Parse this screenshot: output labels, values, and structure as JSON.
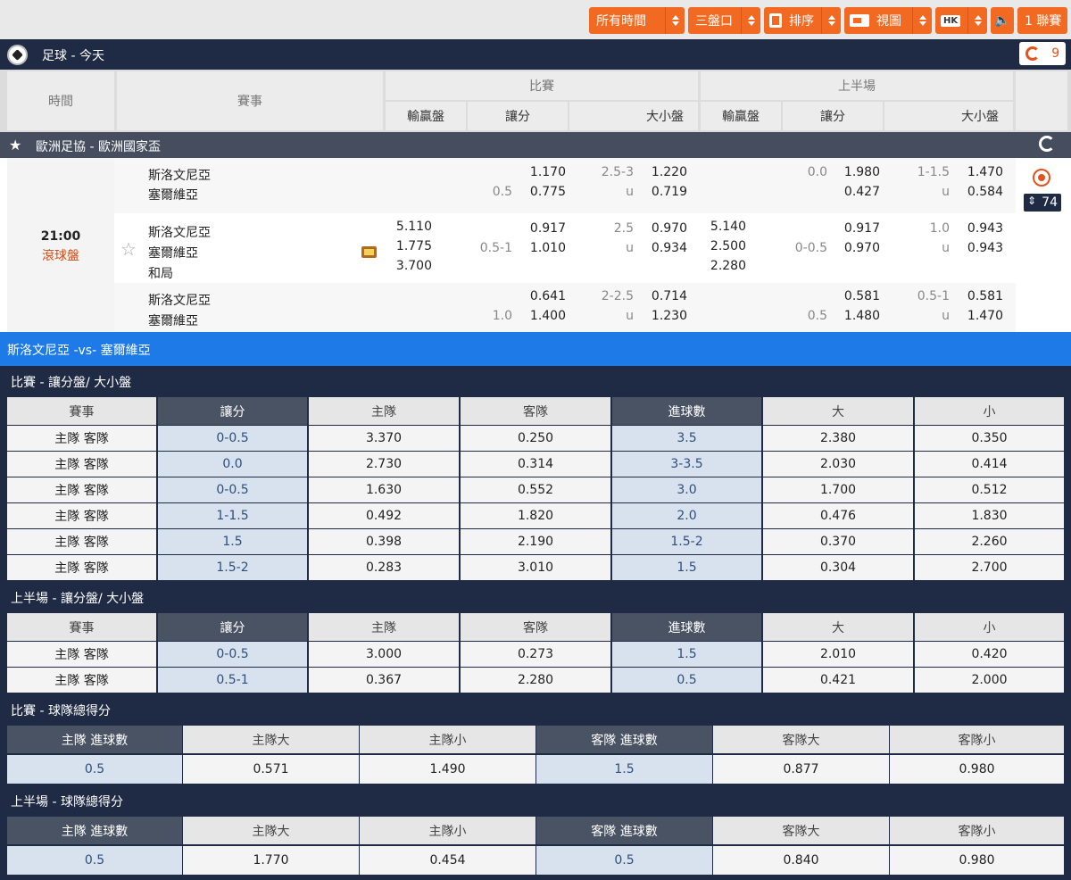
{
  "toolbar": {
    "all_time": "所有時間",
    "three_lines": "三盤口",
    "sort": "排序",
    "view": "視圖",
    "odds_format": "HK",
    "matches": "1 聯賽",
    "accent_color": "#f26a22"
  },
  "sport_header": {
    "title": "足球 - 今天",
    "refresh_count": "9"
  },
  "odds_header": {
    "time": "時間",
    "event": "賽事",
    "full_time": "比賽",
    "first_half": "上半場",
    "cols": [
      "輸贏盤",
      "讓分",
      "大小盤",
      "輸贏盤",
      "讓分",
      "大小盤"
    ]
  },
  "league": {
    "name": "歐洲足協 - 歐洲國家盃"
  },
  "match": {
    "time": "21:00",
    "status": "滾球盤",
    "more_count": "74",
    "rows": [
      {
        "teams": [
          "斯洛文尼亞",
          "塞爾維亞"
        ],
        "ft_1x2": [
          "",
          ""
        ],
        "ft_hdp_line": [
          "",
          "0.5"
        ],
        "ft_hdp_odds": [
          "1.170",
          "0.775"
        ],
        "ft_ou_line": [
          "2.5-3",
          "u"
        ],
        "ft_ou_odds": [
          "1.220",
          "0.719"
        ],
        "h1_1x2": [
          "",
          ""
        ],
        "h1_hdp_line": [
          "0.0",
          ""
        ],
        "h1_hdp_odds": [
          "1.980",
          "0.427"
        ],
        "h1_ou_line": [
          "1-1.5",
          "u"
        ],
        "h1_ou_odds": [
          "1.470",
          "0.584"
        ]
      },
      {
        "teams": [
          "斯洛文尼亞",
          "塞爾維亞",
          "和局"
        ],
        "ft_1x2": [
          "5.110",
          "1.775",
          "3.700"
        ],
        "ft_hdp_line": [
          "",
          "0.5-1"
        ],
        "ft_hdp_odds": [
          "0.917",
          "1.010"
        ],
        "ft_ou_line": [
          "2.5",
          "u"
        ],
        "ft_ou_odds": [
          "0.970",
          "0.934"
        ],
        "h1_1x2": [
          "5.140",
          "2.500",
          "2.280"
        ],
        "h1_hdp_line": [
          "",
          "0-0.5"
        ],
        "h1_hdp_odds": [
          "0.917",
          "0.970"
        ],
        "h1_ou_line": [
          "1.0",
          "u"
        ],
        "h1_ou_odds": [
          "0.943",
          "0.943"
        ]
      },
      {
        "teams": [
          "斯洛文尼亞",
          "塞爾維亞"
        ],
        "ft_1x2": [
          "",
          ""
        ],
        "ft_hdp_line": [
          "",
          "1.0"
        ],
        "ft_hdp_odds": [
          "0.641",
          "1.400"
        ],
        "ft_ou_line": [
          "2-2.5",
          "u"
        ],
        "ft_ou_odds": [
          "0.714",
          "1.230"
        ],
        "h1_1x2": [
          "",
          ""
        ],
        "h1_hdp_line": [
          "",
          "0.5"
        ],
        "h1_hdp_odds": [
          "0.581",
          "1.480"
        ],
        "h1_ou_line": [
          "0.5-1",
          "u"
        ],
        "h1_ou_odds": [
          "0.581",
          "1.470"
        ]
      }
    ]
  },
  "vs_title": "斯洛文尼亞 -vs- 塞爾維亞",
  "ft_hdp_ou": {
    "title": "比賽 - 讓分盤/ 大小盤",
    "headers": [
      "賽事",
      "讓分",
      "主隊",
      "客隊",
      "進球數",
      "大",
      "小"
    ],
    "rows": [
      [
        "主隊 客隊",
        "0-0.5",
        "3.370",
        "0.250",
        "3.5",
        "2.380",
        "0.350"
      ],
      [
        "主隊 客隊",
        "0.0",
        "2.730",
        "0.314",
        "3-3.5",
        "2.030",
        "0.414"
      ],
      [
        "主隊 客隊",
        "0-0.5",
        "1.630",
        "0.552",
        "3.0",
        "1.700",
        "0.512"
      ],
      [
        "主隊 客隊",
        "1-1.5",
        "0.492",
        "1.820",
        "2.0",
        "0.476",
        "1.830"
      ],
      [
        "主隊 客隊",
        "1.5",
        "0.398",
        "2.190",
        "1.5-2",
        "0.370",
        "2.260"
      ],
      [
        "主隊 客隊",
        "1.5-2",
        "0.283",
        "3.010",
        "1.5",
        "0.304",
        "2.700"
      ]
    ]
  },
  "h1_hdp_ou": {
    "title": "上半場 - 讓分盤/ 大小盤",
    "headers": [
      "賽事",
      "讓分",
      "主隊",
      "客隊",
      "進球數",
      "大",
      "小"
    ],
    "rows": [
      [
        "主隊 客隊",
        "0-0.5",
        "3.000",
        "0.273",
        "1.5",
        "2.010",
        "0.420"
      ],
      [
        "主隊 客隊",
        "0.5-1",
        "0.367",
        "2.280",
        "0.5",
        "0.421",
        "2.000"
      ]
    ]
  },
  "ft_team_total": {
    "title": "比賽 - 球隊總得分",
    "headers": [
      "主隊 進球數",
      "主隊大",
      "主隊小",
      "客隊 進球數",
      "客隊大",
      "客隊小"
    ],
    "row": [
      "0.5",
      "0.571",
      "1.490",
      "1.5",
      "0.877",
      "0.980"
    ]
  },
  "h1_team_total": {
    "title": "上半場 - 球隊總得分",
    "headers": [
      "主隊 進球數",
      "主隊大",
      "主隊小",
      "客隊 進球數",
      "客隊大",
      "客隊小"
    ],
    "row": [
      "0.5",
      "1.770",
      "0.454",
      "0.5",
      "0.840",
      "0.980"
    ]
  }
}
